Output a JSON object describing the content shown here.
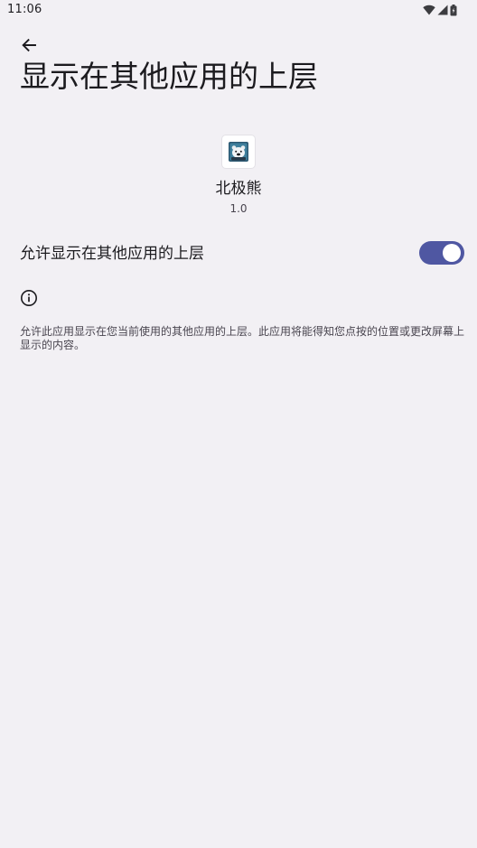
{
  "status_bar": {
    "time": "11:06",
    "icons": [
      "wifi-icon",
      "signal-icon",
      "battery-icon"
    ]
  },
  "header": {
    "back_icon": "arrow-back-icon",
    "title": "显示在其他应用的上层"
  },
  "app": {
    "icon": "polar-bear-app-icon",
    "name": "北极熊",
    "version": "1.0"
  },
  "permission_toggle": {
    "label": "允许显示在其他应用的上层",
    "enabled": true,
    "accent_color": "#4f57a2"
  },
  "info": {
    "icon": "info-icon",
    "text": "允许此应用显示在您当前使用的其他应用的上层。此应用将能得知您点按的位置或更改屏幕上显示的内容。"
  },
  "colors": {
    "background": "#f2f0f4",
    "text_primary": "#1c1b1f",
    "text_secondary": "#49454f"
  }
}
